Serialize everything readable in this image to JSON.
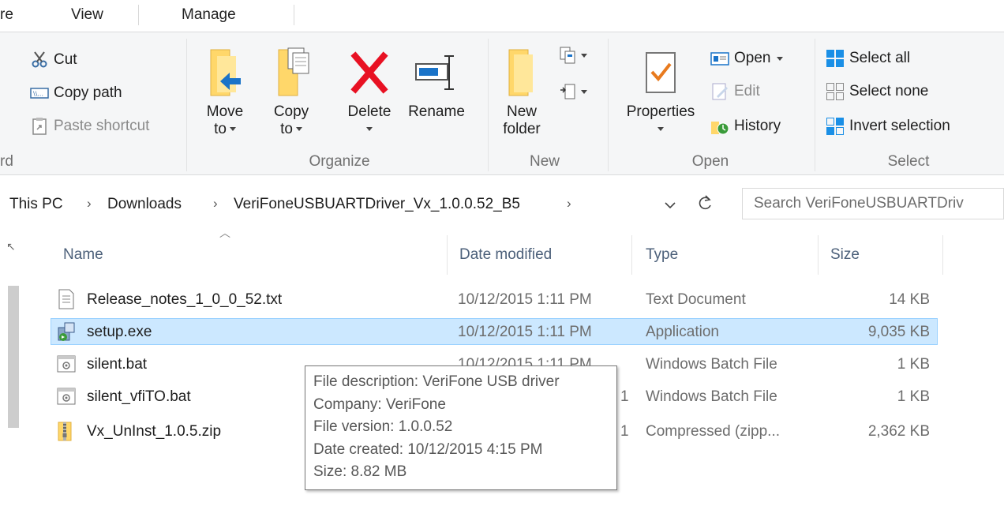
{
  "tabs": {
    "share": "re",
    "view": "View",
    "manage": "Manage"
  },
  "clipboard": {
    "cut": "Cut",
    "copy_path": "Copy path",
    "paste_shortcut": "Paste shortcut",
    "label": "rd"
  },
  "organize": {
    "move_to": [
      "Move",
      "to"
    ],
    "copy_to": [
      "Copy",
      "to"
    ],
    "delete": "Delete",
    "rename": "Rename",
    "label": "Organize"
  },
  "new": {
    "new_folder": [
      "New",
      "folder"
    ],
    "label": "New"
  },
  "open": {
    "properties": "Properties",
    "open": "Open",
    "edit": "Edit",
    "history": "History",
    "label": "Open"
  },
  "select": {
    "select_all": "Select all",
    "select_none": "Select none",
    "invert_selection": "Invert selection",
    "label": "Select"
  },
  "address": {
    "crumbs": [
      "This PC",
      "Downloads",
      "VeriFoneUSBUARTDriver_Vx_1.0.0.52_B5"
    ],
    "search_placeholder": "Search VeriFoneUSBUARTDriv"
  },
  "columns": {
    "name": "Name",
    "date_modified": "Date modified",
    "type": "Type",
    "size": "Size"
  },
  "files": [
    {
      "name": "Release_notes_1_0_0_52.txt",
      "date": "10/12/2015 1:11 PM",
      "type": "Text Document",
      "size": "14 KB",
      "icon": "text-file-icon"
    },
    {
      "name": "setup.exe",
      "date": "10/12/2015 1:11 PM",
      "type": "Application",
      "size": "9,035 KB",
      "icon": "installer-icon",
      "selected": true
    },
    {
      "name": "silent.bat",
      "date": "10/12/2015 1:11 PM",
      "type": "Windows Batch File",
      "size": "1 KB",
      "icon": "batch-file-icon"
    },
    {
      "name": "silent_vfiTO.bat",
      "date": "1",
      "type": "Windows Batch File",
      "size": "1 KB",
      "icon": "batch-file-icon"
    },
    {
      "name": "Vx_UnInst_1.0.5.zip",
      "date": "1",
      "type": "Compressed (zipp...",
      "size": "2,362 KB",
      "icon": "zip-folder-icon"
    }
  ],
  "tooltip": {
    "description": "File description: VeriFone USB driver",
    "company": "Company: VeriFone",
    "version": "File version: 1.0.0.52",
    "created": "Date created: 10/12/2015 4:15 PM",
    "size": "Size: 8.82 MB"
  },
  "colors": {
    "selection_bg": "#cce8ff",
    "selection_border": "#99d1ff",
    "header_text": "#4c607a",
    "ribbon_bg": "#f5f6f7",
    "delete_red": "#e81123",
    "folder_yellow": "#ffd76a"
  }
}
